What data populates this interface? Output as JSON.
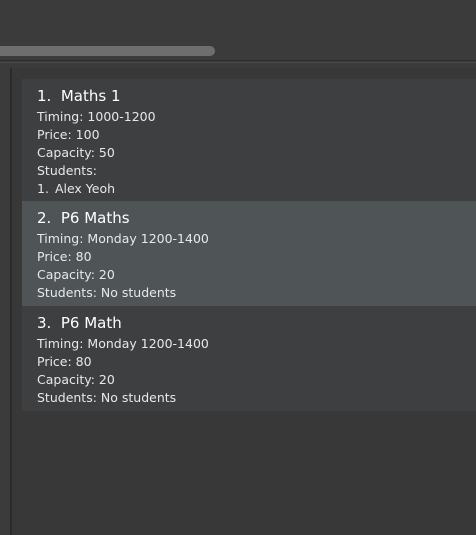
{
  "lessons": [
    {
      "index": "1.",
      "name": "Maths 1",
      "timing": "Timing: 1000-1200",
      "price": "Price: 100",
      "capacity": "Capacity: 50",
      "students_label": "Students:",
      "students": [
        {
          "num": "1.",
          "name": "Alex Yeoh"
        }
      ]
    },
    {
      "index": "2.",
      "name": "P6 Maths",
      "timing": "Timing: Monday 1200-1400",
      "price": "Price: 80",
      "capacity": "Capacity: 20",
      "students_label": "Students: No students"
    },
    {
      "index": "3.",
      "name": "P6 Math",
      "timing": "Timing: Monday 1200-1400",
      "price": "Price: 80",
      "capacity": "Capacity: 20",
      "students_label": "Students: No students"
    }
  ],
  "colors": {
    "background": "#3b3b3b",
    "card": "#3e3f41",
    "card_selected": "#4f5557",
    "scrollbar_thumb": "#6e6e6e",
    "text": "#ffffff"
  }
}
